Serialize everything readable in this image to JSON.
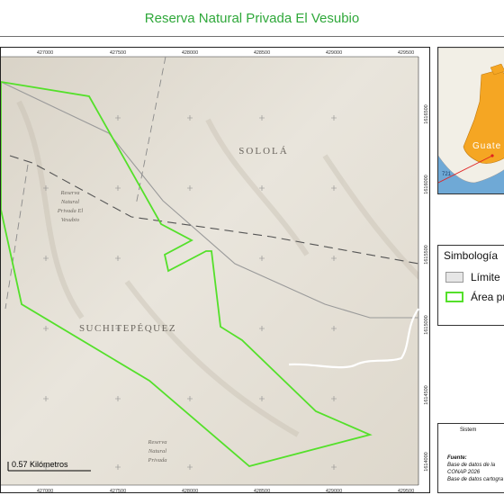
{
  "title": "Reserva Natural Privada El Vesubio",
  "map": {
    "x_ticks": [
      "427000",
      "427500",
      "428000",
      "428500",
      "429000",
      "429500"
    ],
    "y_ticks": [
      "1616500",
      "1616000",
      "1615500",
      "1615000",
      "1614500",
      "1614000"
    ],
    "places": {
      "solola": "SOLOLÁ",
      "suchitepequez": "SUCHITEPÉQUEZ",
      "reserve_top_1": "Reserva",
      "reserve_top_2": "Natural",
      "reserve_top_3": "Privada El",
      "reserve_top_4": "Vesubio",
      "reserve_bottom_1": "Reserva",
      "reserve_bottom_2": "Natural",
      "reserve_bottom_3": "Privada"
    },
    "scale_label": "0.57 Kilómetros",
    "colors": {
      "terrain": "#e6e1d6",
      "protected_area": "#54e02a",
      "boundary": "#7a7a7a"
    }
  },
  "inset": {
    "country_label": "Guate",
    "number_label": "721",
    "colors": {
      "sea": "#6fa9d6",
      "land": "#f2efe6",
      "highlight": "#f5a623",
      "pointer": "#e02020"
    }
  },
  "legend": {
    "title": "Simbología",
    "items": [
      {
        "label": "Límite",
        "swatch_fill": "#e6e6e6",
        "swatch_border": "#9a9a9a"
      },
      {
        "label": "Área pr",
        "swatch_fill": "#ffffff",
        "swatch_border": "#54e02a"
      }
    ]
  },
  "info": {
    "system": "Sistem",
    "source_title": "Fuente:",
    "source_lines": [
      "Base de datos de la",
      "CONAP 2026",
      "Base de datos cartogra"
    ]
  }
}
